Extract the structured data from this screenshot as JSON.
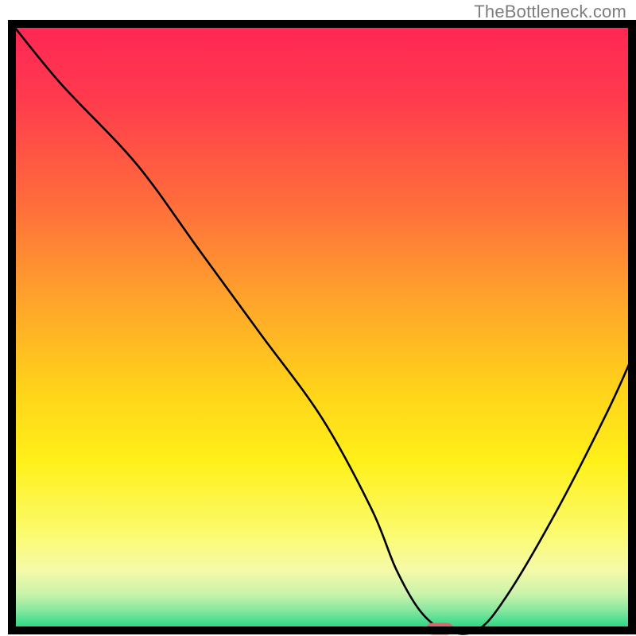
{
  "watermark": "TheBottleneck.com",
  "chart_data": {
    "type": "line",
    "title": "",
    "xlabel": "",
    "ylabel": "",
    "xlim": [
      0,
      100
    ],
    "ylim": [
      0,
      100
    ],
    "x": [
      0,
      8,
      20,
      30,
      40,
      50,
      58,
      62,
      66,
      70,
      75,
      80,
      88,
      96,
      100
    ],
    "values": [
      100,
      90,
      77,
      63,
      49,
      35,
      20,
      10,
      3,
      0,
      0,
      6,
      20,
      36,
      45
    ],
    "minimum_plateau_x": [
      66,
      72
    ],
    "marker": {
      "x": 69,
      "y": 0
    },
    "gradient_stops": [
      {
        "offset": 0.0,
        "color": "#ff2654"
      },
      {
        "offset": 0.12,
        "color": "#ff3a4e"
      },
      {
        "offset": 0.3,
        "color": "#ff6e3b"
      },
      {
        "offset": 0.45,
        "color": "#ffa22c"
      },
      {
        "offset": 0.6,
        "color": "#ffd21a"
      },
      {
        "offset": 0.72,
        "color": "#fff019"
      },
      {
        "offset": 0.84,
        "color": "#fbfb6e"
      },
      {
        "offset": 0.9,
        "color": "#f6faa8"
      },
      {
        "offset": 0.94,
        "color": "#c9f3aa"
      },
      {
        "offset": 0.965,
        "color": "#8ce8a0"
      },
      {
        "offset": 0.985,
        "color": "#4bdc8f"
      },
      {
        "offset": 1.0,
        "color": "#1ed47e"
      }
    ],
    "marker_color": "#d36a6e",
    "frame_color": "#000000",
    "line_color": "#000000"
  }
}
